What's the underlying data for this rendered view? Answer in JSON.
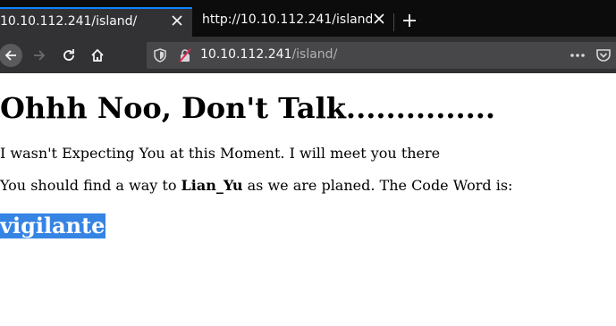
{
  "tabs": [
    {
      "label": "10.10.112.241/island/",
      "active": true
    },
    {
      "label": "http://10.10.112.241/island/",
      "active": false
    }
  ],
  "urlbar": {
    "host": "10.10.112.241",
    "path": "/island/"
  },
  "icons": {
    "back": "arrow-left-icon",
    "forward": "arrow-right-icon",
    "reload": "reload-icon",
    "home": "home-icon",
    "shield": "shield-icon",
    "insecure_lock": "insecure-lock-icon",
    "more": "ellipsis-icon",
    "pocket": "pocket-icon",
    "close": "close-icon",
    "new_tab": "plus-icon"
  },
  "colors": {
    "accent": "#0a84ff",
    "selection": "#3584e4"
  },
  "page": {
    "heading": "Ohhh Noo, Don't Talk...............",
    "para1": "I wasn't Expecting You at this Moment. I will meet you there",
    "para2_prefix": "You should find a way to ",
    "para2_bold": "Lian_Yu",
    "para2_suffix": " as we are planed. The Code Word is:",
    "code_word": "vigilante"
  }
}
